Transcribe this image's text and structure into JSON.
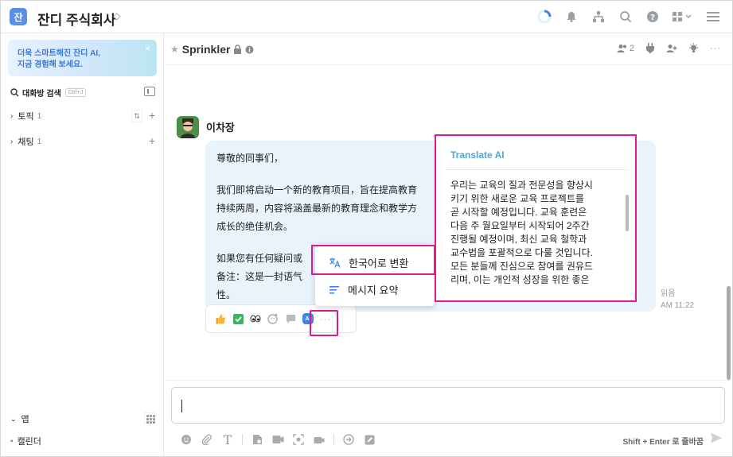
{
  "workspace": {
    "badge": "잔",
    "name": "잔디 주식회사",
    "caret": "◇"
  },
  "sidebar": {
    "promo": {
      "line1": "더욱 스마트해진 잔디 AI,",
      "line2": "지금 경험해 보세요.",
      "close": "×"
    },
    "search": {
      "label": "대화방 검색",
      "shortcut": "Ctrl+J"
    },
    "sections": [
      {
        "label": "토픽",
        "count": "1"
      },
      {
        "label": "채팅",
        "count": "1"
      }
    ],
    "apps": {
      "label": "앱"
    },
    "calendar": {
      "label": "캘린더"
    }
  },
  "channel": {
    "name": "Sprinkler",
    "member_count": "2"
  },
  "message": {
    "sender": "이차장",
    "lines": [
      "尊敬的同事们，",
      "",
      "我们即将启动一个新的教育项目，旨在提高教育",
      "持续两周，内容将涵盖最新的教育理念和教学方",
      "成长的绝佳机会。",
      "",
      "如果您有任何疑问或",
      "备注：这是一封语气",
      "性。"
    ],
    "read": "읽음",
    "time": "AM 11:22"
  },
  "dropdown": {
    "items": [
      {
        "label": "한국어로 변환",
        "icon": "translate-icon"
      },
      {
        "label": "메시지 요약",
        "icon": "summary-icon"
      }
    ]
  },
  "translate": {
    "title": "Translate AI",
    "lines": [
      "우리는 교육의 질과 전문성을 향상시",
      "키기 위한 새로운 교육 프로젝트를",
      "곧 시작할 예정입니다. 교육 훈련은",
      "다음 주 월요일부터 시작되어 2주간",
      "진행될 예정이며, 최신 교육 철학과",
      "교수법을 포괄적으로 다룰 것입니다.",
      "모든 분들께 진심으로 참여를 권유드",
      "리며, 이는 개인적 성장을 위한 좋은"
    ]
  },
  "reactions": {
    "ai_label": "AI"
  },
  "composer": {
    "hint": "Shift + Enter 로 줄바꿈"
  }
}
